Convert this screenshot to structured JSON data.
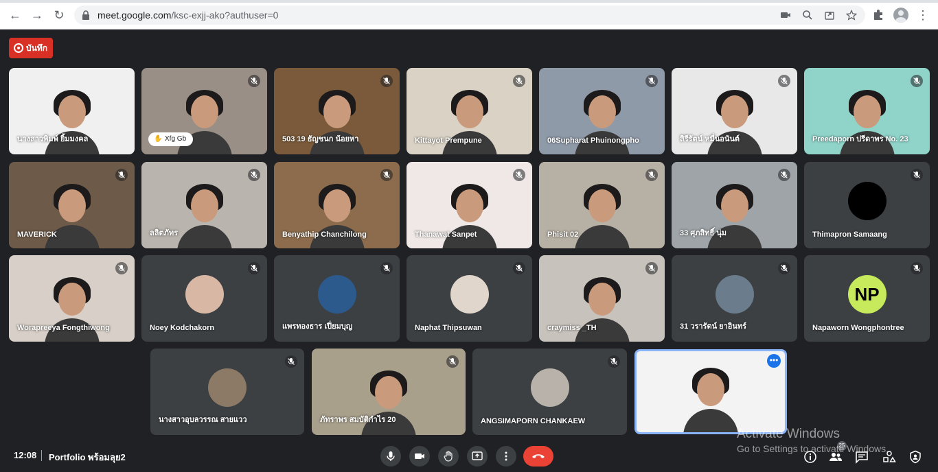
{
  "browser": {
    "url_host": "meet.google.com",
    "url_path": "/ksc-exjj-ako?authuser=0"
  },
  "recording": {
    "label": "บันทึก"
  },
  "tiles": [
    {
      "name": "นางสาวพิมพ์ ยิ้มมงคล",
      "muted": false,
      "kind": "video",
      "bg": "#f0f0f0"
    },
    {
      "name": "",
      "muted": true,
      "kind": "video",
      "bg": "#9a8f86",
      "hand_label": "Xfg Gb"
    },
    {
      "name": "503 19 ธัญชนก น้อยหา",
      "muted": true,
      "kind": "video",
      "bg": "#7a5a3a"
    },
    {
      "name": "Kittayot Prempune",
      "muted": true,
      "kind": "video",
      "bg": "#d9d2c5"
    },
    {
      "name": "06Supharat Phuinongpho",
      "muted": true,
      "kind": "video",
      "bg": "#8f9aa8"
    },
    {
      "name": "สิรีรัตน์ หมื่นอนันต์",
      "muted": true,
      "kind": "video",
      "bg": "#e8e8e8"
    },
    {
      "name": "Preedaporn ปรีดาพร No. 23",
      "muted": true,
      "kind": "video",
      "bg": "#8fd3c9"
    },
    {
      "name": "MAVERICK",
      "muted": true,
      "kind": "video",
      "bg": "#6e5a48"
    },
    {
      "name": "ลลิตภัทร",
      "muted": true,
      "kind": "video",
      "bg": "#b9b4ad"
    },
    {
      "name": "Benyathip Chanchilong",
      "muted": true,
      "kind": "video",
      "bg": "#8c6c4c"
    },
    {
      "name": "Thanawat Sanpet",
      "muted": true,
      "kind": "video",
      "bg": "#efe8e6"
    },
    {
      "name": "Phisit 02",
      "muted": true,
      "kind": "video",
      "bg": "#b7b0a4"
    },
    {
      "name": "33 ศุภสิทธิ์ นุ่ม",
      "muted": true,
      "kind": "video",
      "bg": "#9ea4a8"
    },
    {
      "name": "Thimapron Samaang",
      "muted": true,
      "kind": "avatar",
      "avatar_bg": "#000000",
      "avatar_text": ""
    },
    {
      "name": "Worapreeya Fongthiwong",
      "muted": true,
      "kind": "video",
      "bg": "#d8d0c8"
    },
    {
      "name": "Noey Kodchakorn",
      "muted": true,
      "kind": "avatar",
      "avatar_bg": "#d9b7a5",
      "avatar_text": ""
    },
    {
      "name": "แพรทองธาร เปี่ยมบุญ",
      "muted": true,
      "kind": "avatar",
      "avatar_bg": "#2c5a8c",
      "avatar_text": ""
    },
    {
      "name": "Naphat Thipsuwan",
      "muted": true,
      "kind": "avatar",
      "avatar_bg": "#e0d6cc",
      "avatar_text": ""
    },
    {
      "name": "craymiss _TH",
      "muted": true,
      "kind": "video",
      "bg": "#c8c2bc"
    },
    {
      "name": "31 วรารัตน์ ยาอินทร์",
      "muted": true,
      "kind": "avatar",
      "avatar_bg": "#6b7d8c",
      "avatar_text": ""
    },
    {
      "name": "Napaworn Wongphontree",
      "muted": true,
      "kind": "avatar",
      "avatar_bg": "#c6ea5b",
      "avatar_text": "NP"
    },
    {
      "name": "นางสาวอุบลวรรณ สายแวว",
      "muted": true,
      "kind": "avatar",
      "avatar_bg": "#8c7a66",
      "avatar_text": ""
    },
    {
      "name": "ภัทราพร สมบัติกำไร 20",
      "muted": true,
      "kind": "video",
      "bg": "#a9a08c"
    },
    {
      "name": "ANGSIMAPORN CHANKAEW",
      "muted": true,
      "kind": "avatar",
      "avatar_bg": "#b8b2aa",
      "avatar_text": ""
    },
    {
      "name": "",
      "muted": false,
      "kind": "video",
      "bg": "#f3f3f3",
      "self": true
    }
  ],
  "bottom": {
    "time": "12:08",
    "meeting_title": "Portfolio พร้อมลุย2",
    "participants_count": "25"
  },
  "overlay": {
    "activate_title": "Activate Windows",
    "activate_subtitle": "Go to Settings to activate Windows."
  },
  "colors": {
    "accent": "#1a73e8",
    "record": "#d93025",
    "end_call": "#ea4335",
    "tile": "#3c4043",
    "background": "#202124"
  },
  "icons": [
    "back-icon",
    "forward-icon",
    "reload-icon",
    "lock-icon",
    "camera-icon",
    "zoom-icon",
    "share-icon",
    "star-icon",
    "extensions-icon",
    "mic-icon",
    "video-icon",
    "raise-hand-icon",
    "present-icon",
    "more-icon",
    "end-call-icon",
    "info-icon",
    "people-icon",
    "chat-icon",
    "activities-icon",
    "host-controls-icon"
  ]
}
